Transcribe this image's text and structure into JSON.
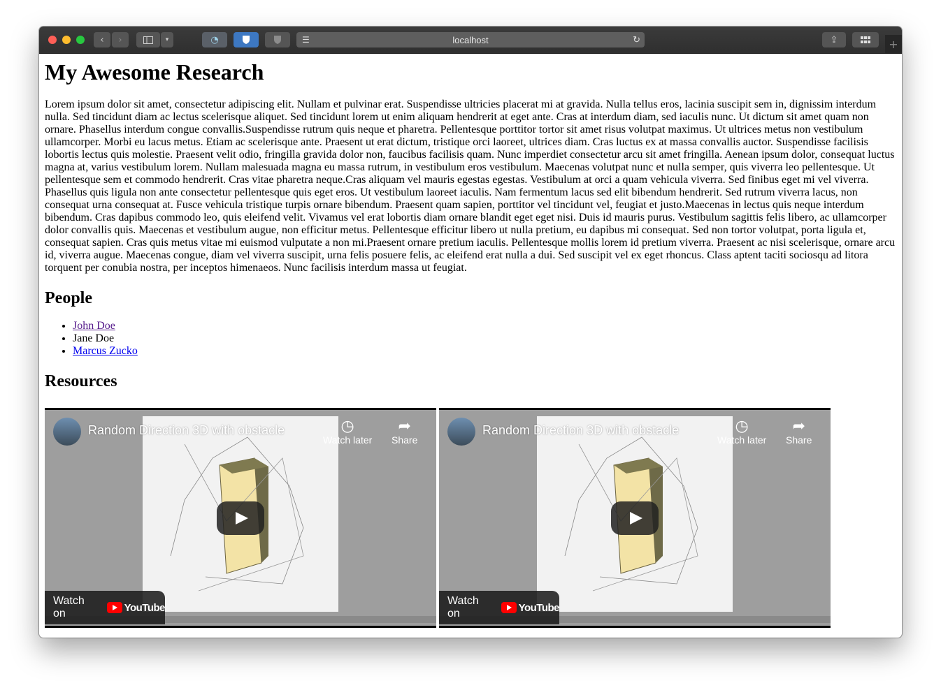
{
  "browser": {
    "address": "localhost",
    "icons": [
      "back-icon",
      "forward-icon",
      "sidebar-icon",
      "chevron-down-icon",
      "ghost-extension-icon",
      "bitwarden-shield-icon",
      "privacy-shield-icon",
      "reader-icon",
      "reload-icon",
      "share-icon",
      "tab-overview-icon",
      "new-tab-icon"
    ],
    "new_tab": "+"
  },
  "page": {
    "title": "My Awesome Research",
    "paragraph": "Lorem ipsum dolor sit amet, consectetur adipiscing elit. Nullam et pulvinar erat. Suspendisse ultricies placerat mi at gravida. Nulla tellus eros, lacinia suscipit sem in, dignissim interdum nulla. Sed tincidunt diam ac lectus scelerisque aliquet. Sed tincidunt lorem ut enim aliquam hendrerit at eget ante. Cras at interdum diam, sed iaculis nunc. Ut dictum sit amet quam non ornare. Phasellus interdum congue convallis.Suspendisse rutrum quis neque et pharetra. Pellentesque porttitor tortor sit amet risus volutpat maximus. Ut ultrices metus non vestibulum ullamcorper. Morbi eu lacus metus. Etiam ac scelerisque ante. Praesent ut erat dictum, tristique orci laoreet, ultrices diam. Cras luctus ex at massa convallis auctor. Suspendisse facilisis lobortis lectus quis molestie. Praesent velit odio, fringilla gravida dolor non, faucibus facilisis quam. Nunc imperdiet consectetur arcu sit amet fringilla. Aenean ipsum dolor, consequat luctus magna at, varius vestibulum lorem. Nullam malesuada magna eu massa rutrum, in vestibulum eros vestibulum. Maecenas volutpat nunc et nulla semper, quis viverra leo pellentesque. Ut pellentesque sem et commodo hendrerit. Cras vitae pharetra neque.Cras aliquam vel mauris egestas egestas. Vestibulum at orci a quam vehicula viverra. Sed finibus eget mi vel viverra. Phasellus quis ligula non ante consectetur pellentesque quis eget eros. Ut vestibulum laoreet iaculis. Nam fermentum lacus sed elit bibendum hendrerit. Sed rutrum viverra lacus, non consequat urna consequat at. Fusce vehicula tristique turpis ornare bibendum. Praesent quam sapien, porttitor vel tincidunt vel, feugiat et justo.Maecenas in lectus quis neque interdum bibendum. Cras dapibus commodo leo, quis eleifend velit. Vivamus vel erat lobortis diam ornare blandit eget eget nisi. Duis id mauris purus. Vestibulum sagittis felis libero, ac ullamcorper dolor convallis quis. Maecenas et vestibulum augue, non efficitur metus. Pellentesque efficitur libero ut nulla pretium, eu dapibus mi consequat. Sed non tortor volutpat, porta ligula et, consequat sapien. Cras quis metus vitae mi euismod vulputate a non mi.Praesent ornare pretium iaculis. Pellentesque mollis lorem id pretium viverra. Praesent ac nisi scelerisque, ornare arcu id, viverra augue. Maecenas congue, diam vel viverra suscipit, urna felis posuere felis, ac eleifend erat nulla a dui. Sed suscipit vel ex eget rhoncus. Class aptent taciti sociosqu ad litora torquent per conubia nostra, per inceptos himenaeos. Nunc facilisis interdum massa ut feugiat.",
    "people_heading": "People",
    "people": [
      {
        "name": "John Doe",
        "link": "visited"
      },
      {
        "name": "Jane Doe",
        "link": "none"
      },
      {
        "name": "Marcus Zucko",
        "link": "unvisited"
      }
    ],
    "resources_heading": "Resources"
  },
  "videos": [
    {
      "title": "Random Direction 3D with obstacle",
      "watch_later": "Watch later",
      "share": "Share",
      "watch_on": "Watch on",
      "brand": "YouTube"
    },
    {
      "title": "Random Direction 3D with obstacle",
      "watch_later": "Watch later",
      "share": "Share",
      "watch_on": "Watch on",
      "brand": "YouTube"
    }
  ],
  "colors": {
    "visited_link": "#551a8b",
    "unvisited_link": "#0000ee",
    "youtube_red": "#ff0000"
  }
}
